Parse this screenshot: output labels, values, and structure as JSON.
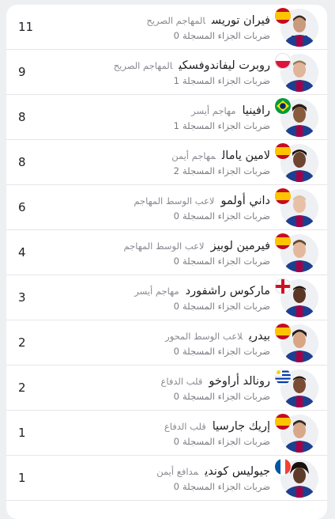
{
  "players": [
    {
      "name": "فيران توريس",
      "position": "المهاجم الصريح",
      "stat_label": "ضربات الجزاء المسجلة",
      "stat_value": "0",
      "count": "11",
      "flag": "spain-flag-icon"
    },
    {
      "name": "روبرت ليفاندوفسكي",
      "position": "المهاجم الصريح",
      "stat_label": "ضربات الجزاء المسجلة",
      "stat_value": "1",
      "count": "9",
      "flag": "poland-flag-icon"
    },
    {
      "name": "رافينيا",
      "position": "مهاجم أيسر",
      "stat_label": "ضربات الجزاء المسجلة",
      "stat_value": "1",
      "count": "8",
      "flag": "brazil-flag-icon"
    },
    {
      "name": "لامين يامال",
      "position": "مهاجم أيمن",
      "stat_label": "ضربات الجزاء المسجلة",
      "stat_value": "2",
      "count": "8",
      "flag": "spain-flag-icon"
    },
    {
      "name": "داني أولمو",
      "position": "لاعب الوسط المهاجم",
      "stat_label": "ضربات الجزاء المسجلة",
      "stat_value": "0",
      "count": "6",
      "flag": "spain-flag-icon"
    },
    {
      "name": "فيرمين لوبيز",
      "position": "لاعب الوسط المهاجم",
      "stat_label": "ضربات الجزاء المسجلة",
      "stat_value": "0",
      "count": "4",
      "flag": "spain-flag-icon"
    },
    {
      "name": "ماركوس راشفورد",
      "position": "مهاجم أيسر",
      "stat_label": "ضربات الجزاء المسجلة",
      "stat_value": "0",
      "count": "3",
      "flag": "england-flag-icon"
    },
    {
      "name": "بيدري",
      "position": "لاعب الوسط المحور",
      "stat_label": "ضربات الجزاء المسجلة",
      "stat_value": "0",
      "count": "2",
      "flag": "spain-flag-icon"
    },
    {
      "name": "رونالد أراوخو",
      "position": "قلب الدفاع",
      "stat_label": "ضربات الجزاء المسجلة",
      "stat_value": "0",
      "count": "2",
      "flag": "uruguay-flag-icon"
    },
    {
      "name": "إريك جارسيا",
      "position": "قلب الدفاع",
      "stat_label": "ضربات الجزاء المسجلة",
      "stat_value": "0",
      "count": "1",
      "flag": "spain-flag-icon"
    },
    {
      "name": "جيوليس كوندي",
      "position": "مدافع أيمن",
      "stat_label": "ضربات الجزاء المسجلة",
      "stat_value": "0",
      "count": "1",
      "flag": "france-flag-icon"
    }
  ],
  "colors": {
    "kit_blue": "#1d3f8f",
    "kit_red": "#a50044",
    "row_divider": "#e6e6e9",
    "muted_text": "#8a8a92"
  }
}
